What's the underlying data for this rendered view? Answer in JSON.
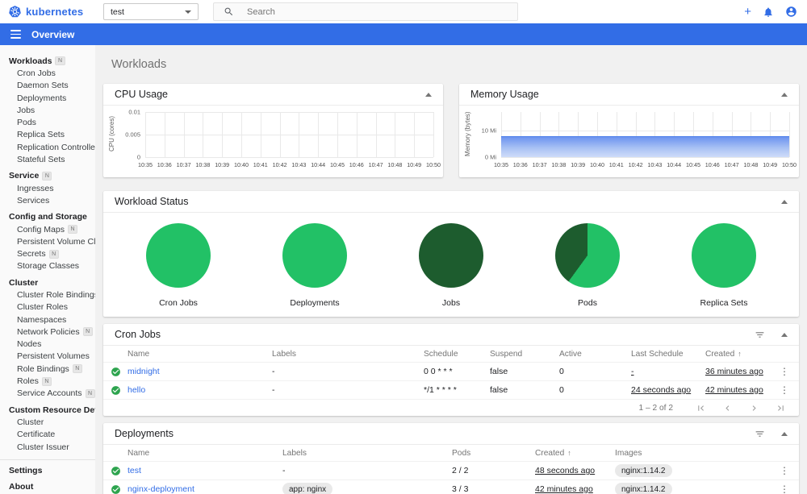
{
  "colors": {
    "brand_blue": "#326de6",
    "link_blue": "#326de6",
    "success_green": "#2da44e",
    "pie_light_green": "#22c166",
    "pie_dark_green": "#1d5c2e",
    "area_blue_top": "#6c93ef",
    "area_blue_bottom": "#cfdcf9"
  },
  "header": {
    "logo_text": "kubernetes",
    "namespace_value": "test",
    "search_placeholder": "Search",
    "icons": [
      "plus-icon",
      "bell-icon",
      "account-icon"
    ]
  },
  "toolbar": {
    "title": "Overview"
  },
  "sidebar": {
    "badge_text": "N",
    "items": [
      {
        "type": "top",
        "label": "Workloads",
        "badge": true
      },
      {
        "type": "child",
        "label": "Cron Jobs"
      },
      {
        "type": "child",
        "label": "Daemon Sets"
      },
      {
        "type": "child",
        "label": "Deployments"
      },
      {
        "type": "child",
        "label": "Jobs"
      },
      {
        "type": "child",
        "label": "Pods"
      },
      {
        "type": "child",
        "label": "Replica Sets"
      },
      {
        "type": "child",
        "label": "Replication Controllers"
      },
      {
        "type": "child",
        "label": "Stateful Sets"
      },
      {
        "type": "top",
        "label": "Service",
        "badge": true
      },
      {
        "type": "child",
        "label": "Ingresses"
      },
      {
        "type": "child",
        "label": "Services"
      },
      {
        "type": "header",
        "label": "Config and Storage"
      },
      {
        "type": "child",
        "label": "Config Maps",
        "badge": true
      },
      {
        "type": "child",
        "label": "Persistent Volume Claims",
        "badge": true
      },
      {
        "type": "child",
        "label": "Secrets",
        "badge": true
      },
      {
        "type": "child",
        "label": "Storage Classes"
      },
      {
        "type": "header",
        "label": "Cluster"
      },
      {
        "type": "child",
        "label": "Cluster Role Bindings"
      },
      {
        "type": "child",
        "label": "Cluster Roles"
      },
      {
        "type": "child",
        "label": "Namespaces"
      },
      {
        "type": "child",
        "label": "Network Policies",
        "badge": true
      },
      {
        "type": "child",
        "label": "Nodes"
      },
      {
        "type": "child",
        "label": "Persistent Volumes"
      },
      {
        "type": "child",
        "label": "Role Bindings",
        "badge": true
      },
      {
        "type": "child",
        "label": "Roles",
        "badge": true
      },
      {
        "type": "child",
        "label": "Service Accounts",
        "badge": true
      },
      {
        "type": "header",
        "label": "Custom Resource Definitions"
      },
      {
        "type": "child",
        "label": "Cluster"
      },
      {
        "type": "child",
        "label": "Certificate"
      },
      {
        "type": "child",
        "label": "Cluster Issuer"
      },
      {
        "type": "divider"
      },
      {
        "type": "top",
        "label": "Settings"
      },
      {
        "type": "top",
        "label": "About"
      }
    ]
  },
  "page": {
    "title": "Workloads"
  },
  "chart_data": [
    {
      "id": "cpu",
      "type": "line",
      "title": "CPU Usage",
      "ylabel": "CPU (cores)",
      "x": [
        "10:35",
        "10:36",
        "10:37",
        "10:38",
        "10:39",
        "10:40",
        "10:41",
        "10:42",
        "10:43",
        "10:44",
        "10:45",
        "10:46",
        "10:47",
        "10:48",
        "10:49",
        "10:50"
      ],
      "yticks": [
        {
          "label": "0",
          "value": 0
        },
        {
          "label": "0.005",
          "value": 0.005
        },
        {
          "label": "0.01",
          "value": 0.01
        }
      ],
      "ylim": [
        0,
        0.01
      ],
      "series": [],
      "grid": true
    },
    {
      "id": "memory",
      "type": "area",
      "title": "Memory Usage",
      "ylabel": "Memory (bytes)",
      "x": [
        "10:35",
        "10:36",
        "10:37",
        "10:38",
        "10:39",
        "10:40",
        "10:41",
        "10:42",
        "10:43",
        "10:44",
        "10:45",
        "10:46",
        "10:47",
        "10:48",
        "10:49",
        "10:50"
      ],
      "yticks": [
        {
          "label": "0 Mi",
          "value": 0
        },
        {
          "label": "10 Mi",
          "value": 10
        }
      ],
      "ylim": [
        0,
        17
      ],
      "unit": "Mi",
      "series": [
        {
          "name": "Memory usage",
          "values": [
            8,
            8,
            8,
            8,
            8,
            8,
            8,
            8,
            8,
            8,
            8,
            8,
            8,
            8,
            8,
            8
          ]
        }
      ],
      "grid": true
    },
    {
      "id": "workload-status",
      "type": "pie",
      "title": "Workload Status",
      "charts": [
        {
          "label": "Cron Jobs",
          "slices": [
            {
              "pct": 100,
              "color": "#22c166"
            }
          ]
        },
        {
          "label": "Deployments",
          "slices": [
            {
              "pct": 100,
              "color": "#22c166"
            }
          ]
        },
        {
          "label": "Jobs",
          "slices": [
            {
              "pct": 100,
              "color": "#1d5c2e"
            }
          ]
        },
        {
          "label": "Pods",
          "slices": [
            {
              "pct": 60,
              "color": "#22c166"
            },
            {
              "pct": 40,
              "color": "#1d5c2e"
            }
          ]
        },
        {
          "label": "Replica Sets",
          "slices": [
            {
              "pct": 100,
              "color": "#22c166"
            }
          ]
        }
      ]
    }
  ],
  "cron_jobs": {
    "title": "Cron Jobs",
    "columns": [
      "Name",
      "Labels",
      "Schedule",
      "Suspend",
      "Active",
      "Last Schedule",
      "Created"
    ],
    "sorted_by": "Created",
    "sort_arrow": "↑",
    "rows": [
      {
        "status": "success",
        "name": "midnight",
        "labels": "-",
        "schedule": "0 0 * * *",
        "suspend": "false",
        "active": "0",
        "last_schedule": "-",
        "created": "36 minutes ago"
      },
      {
        "status": "success",
        "name": "hello",
        "labels": "-",
        "schedule": "*/1 * * * *",
        "suspend": "false",
        "active": "0",
        "last_schedule": "24 seconds ago",
        "created": "42 minutes ago"
      }
    ],
    "pagination": {
      "range": "1 – 2 of 2"
    }
  },
  "deployments": {
    "title": "Deployments",
    "columns": [
      "Name",
      "Labels",
      "Pods",
      "Created",
      "Images"
    ],
    "sorted_by": "Created",
    "sort_arrow": "↑",
    "rows": [
      {
        "status": "success",
        "name": "test",
        "labels": "-",
        "labels_chip": false,
        "pods": "2 / 2",
        "created": "48 seconds ago",
        "images": "nginx:1.14.2"
      },
      {
        "status": "success",
        "name": "nginx-deployment",
        "labels": "app: nginx",
        "labels_chip": true,
        "pods": "3 / 3",
        "created": "42 minutes ago",
        "images": "nginx:1.14.2"
      }
    ]
  }
}
